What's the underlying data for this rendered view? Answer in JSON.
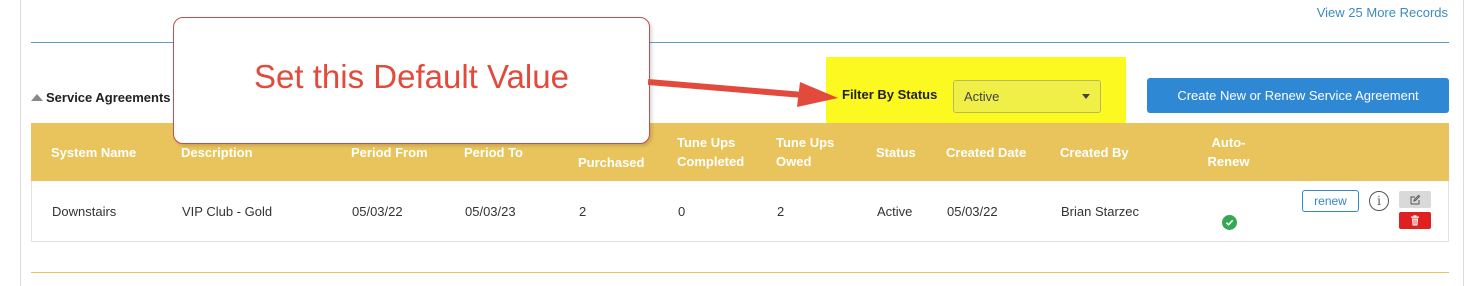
{
  "header": {
    "view_more_label": "View 25 More Records"
  },
  "section": {
    "title": "Service Agreements"
  },
  "filter": {
    "label": "Filter By Status",
    "selected": "Active"
  },
  "actions": {
    "create_label": "Create New or Renew Service Agreement"
  },
  "table": {
    "columns": {
      "system_name": "System Name",
      "description": "Description",
      "period_from": "Period From",
      "period_to": "Period To",
      "tune_ups_purchased": "Purchased",
      "tune_ups_completed": "Tune Ups Completed",
      "tune_ups_owed": "Tune Ups Owed",
      "status": "Status",
      "created_date": "Created Date",
      "created_by": "Created By",
      "auto_renew": "Auto-Renew"
    },
    "rows": [
      {
        "system_name": "Downstairs",
        "description": "VIP Club - Gold",
        "period_from": "05/03/22",
        "period_to": "05/03/23",
        "tune_ups_purchased": "2",
        "tune_ups_completed": "0",
        "tune_ups_owed": "2",
        "status": "Active",
        "created_date": "05/03/22",
        "created_by": "Brian Starzec",
        "auto_renew": true,
        "renew_label": "renew"
      }
    ]
  },
  "annotation": {
    "callout_text": "Set this Default Value"
  },
  "colors": {
    "header_bg": "#e9c45c",
    "primary": "#2f88d3",
    "highlight": "#fbf91f",
    "callout_text": "#e24a3b",
    "delete": "#e02020",
    "success": "#34a853"
  },
  "icons": {
    "section_toggle": "caret-up-icon",
    "select": "chevron-down-icon",
    "info": "info-icon",
    "edit": "edit-icon",
    "delete": "trash-icon",
    "auto_renew": "check-circle-icon"
  }
}
